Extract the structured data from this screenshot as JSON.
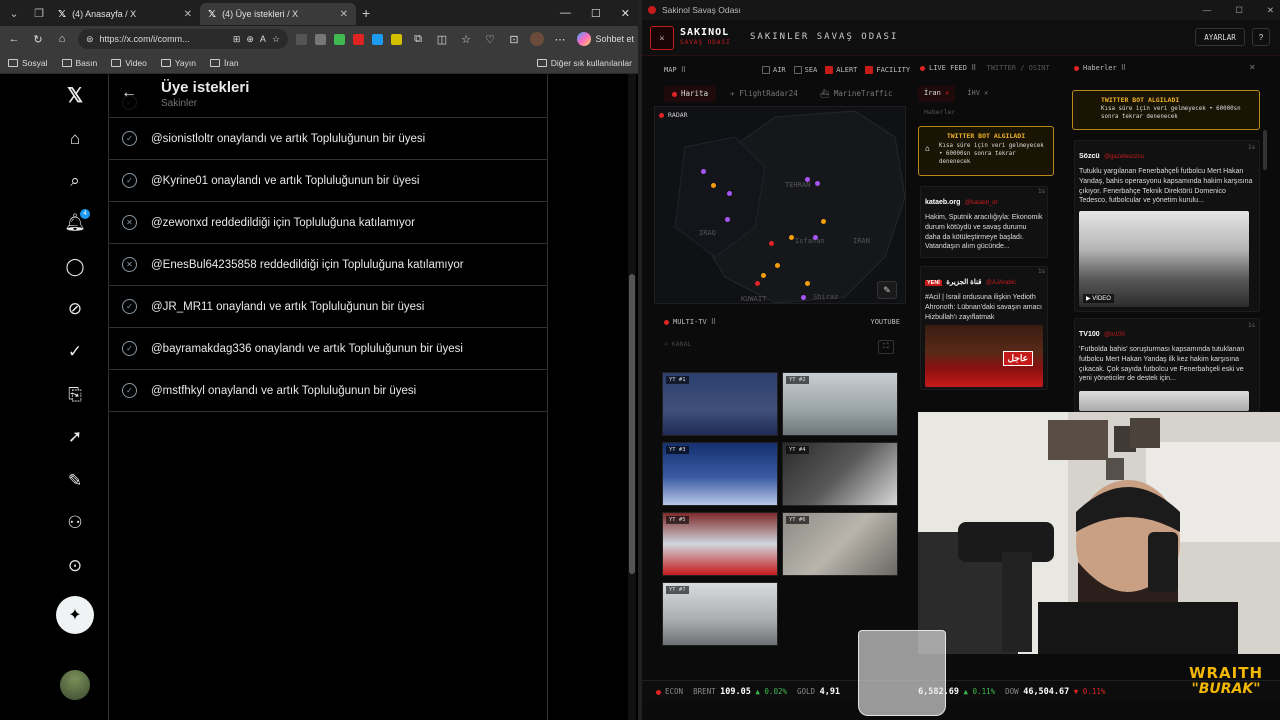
{
  "browser": {
    "tabs": [
      {
        "label": "(4) Anasayfa / X"
      },
      {
        "label": "(4) Üye istekleri / X"
      }
    ],
    "new_tab": "+",
    "url": "https://x.com/i/comm...",
    "copilot_label": "Sohbet et",
    "bookmarks": [
      "Sosyal",
      "Basın",
      "Video",
      "Yayın",
      "İran"
    ],
    "bookmarks_other": "Diğer sık kullanılanlar"
  },
  "x": {
    "title": "Üye istekleri",
    "subtitle": "Sakinler",
    "notification_count": "4",
    "rows": [
      {
        "icon": "check",
        "text": "@sionistloltr onaylandı ve artık Topluluğunun bir üyesi"
      },
      {
        "icon": "check",
        "text": "@Kyrine01 onaylandı ve artık Topluluğunun bir üyesi"
      },
      {
        "icon": "cross",
        "text": "@zewonxd reddedildiği için Topluluğuna katılamıyor"
      },
      {
        "icon": "cross",
        "text": "@EnesBul64235858 reddedildiği için Topluluğuna katılamıyor"
      },
      {
        "icon": "check",
        "text": "@JR_MR11 onaylandı ve artık Topluluğunun bir üyesi"
      },
      {
        "icon": "check",
        "text": "@bayramakdag336 onaylandı ve artık Topluluğunun bir üyesi"
      },
      {
        "icon": "check",
        "text": "@mstfhkyl onaylandı ve artık Topluluğunun bir üyesi"
      }
    ]
  },
  "app": {
    "window_title": "Sakinol Savaş Odası",
    "logo_title": "SAKINOL",
    "logo_sub": "SAVAŞ ODASI",
    "name": "SAKINLER SAVAŞ ODASI",
    "settings_label": "AYARLAR",
    "help_label": "?",
    "map": {
      "label": "MAP ⠿",
      "filters": [
        {
          "label": "AIR",
          "on": false
        },
        {
          "label": "SEA",
          "on": false
        },
        {
          "label": "ALERT",
          "on": true
        },
        {
          "label": "FACILITY",
          "on": true
        }
      ],
      "tabs": [
        "Harita",
        "FlightRadar24",
        "MarineTraffic"
      ],
      "radar_label": "RADAR",
      "places": [
        "TEHRAN",
        "IRAQ",
        "IRAN",
        "KUWAIT",
        "Isfahan",
        "Shiraz"
      ]
    },
    "multitv": {
      "label": "MULTI-TV ⠿",
      "source": "YOUTUBE",
      "search_hint": "⌕ KANAL",
      "screens": [
        "YT #1",
        "YT #2",
        "YT #3",
        "YT #4",
        "YT #5",
        "YT #6",
        "YT #7"
      ]
    },
    "livefeed": {
      "label": "LIVE FEED ⠿",
      "sub_label": "TWITTER / OSINT",
      "tabs": [
        "İran",
        "İHV"
      ],
      "section": "Haberler",
      "alert_title": "TWITTER BOT ALGILADI",
      "alert_body": "Kısa süre için veri gelmeyecek • 60000sn sonra tekrar denenecek",
      "items": [
        {
          "source": "kataeb.org",
          "handle": "@kataeb_dr",
          "time": "1s",
          "text": "Hakim, Sputnik aracılığıyla: Ekonomik durum kötüydü ve savaş durumu daha da kötüleştirmeye başladı. Vatandaşın alım gücünde..."
        },
        {
          "badge": "YENİ",
          "source": "قناة الجزيرة",
          "handle": "@AJArabic",
          "time": "1s",
          "text": "#Acil | İsrail ordusuna ilişkin Yedioth Ahronoth: Lübnan'daki savaşın amacı Hizbullah'ı zayıflatmak"
        }
      ],
      "image_caption": "عاجل"
    },
    "news": {
      "label": "Haberler ⠿",
      "close": "✕",
      "alert_title": "TWITTER BOT ALGILADI",
      "alert_body": "Kısa süre için veri gelmeyecek • 60000sn sonra tekrar denenecek",
      "items": [
        {
          "source": "Sözcü",
          "handle": "@gazetesozcu",
          "time": "1s",
          "text": "Tutuklu yargılanan Fenerbahçeli futbolcu Mert Hakan Yandaş, bahis operasyonu kapsamında hakim karşısına çıkıyor. Fenerbahçe Teknik Direktörü Domenico Tedesco, futbolcular ve yönetim kurulu..."
        },
        {
          "source": "TV100",
          "handle": "@tv100",
          "time": "1s",
          "text": "'Futbolda bahis' soruşturması kapsamında tutuklanan futbolcu Mert Hakan Yandaş ilk kez hakim karşısına çıkacak. Çok sayıda futbolcu ve Fenerbahçeli eski ve yeni yöneticiler de destek için..."
        }
      ],
      "video_label": "▶ VİDEO"
    },
    "ticker": [
      {
        "label": "ECON",
        "value": "",
        "change": ""
      },
      {
        "label": "BRENT",
        "value": "109.05",
        "change": "▲ 0.02%",
        "dir": "up"
      },
      {
        "label": "GOLD",
        "value": "4,91",
        "change": "",
        "dir": "up"
      },
      {
        "label": "",
        "value": "6,582.69",
        "change": "▲ 0.11%",
        "dir": "up"
      },
      {
        "label": "DOW",
        "value": "46,504.67",
        "change": "▼ 0.11%",
        "dir": "down"
      }
    ]
  },
  "overlay": {
    "logo_line1": "WRAITH",
    "logo_line2": "\"BURAK\""
  },
  "colors": {
    "x_bg": "#000000",
    "x_border": "#2f3336",
    "app_red": "#c61b1b",
    "alert_gold": "#f0b429",
    "ticker_up": "#3fb950",
    "ticker_down": "#e02424"
  }
}
